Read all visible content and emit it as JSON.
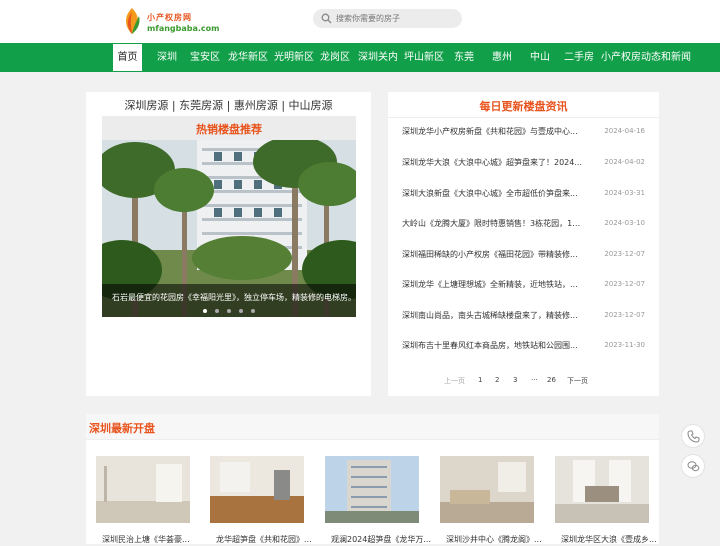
{
  "header": {
    "logo_cn": "小产权房网",
    "logo_en": "mfangbaba.com",
    "search_placeholder": "搜索你需要的房子"
  },
  "nav": [
    "首页",
    "深圳",
    "宝安区",
    "龙华新区",
    "光明新区",
    "龙岗区",
    "深圳关内",
    "坪山新区",
    "东莞",
    "惠州",
    "中山",
    "二手房",
    "小产权房动态和新闻"
  ],
  "left": {
    "cities": "深圳房源 | 东莞房源 | 惠州房源 | 中山房源",
    "hot_title": "热销楼盘推荐",
    "carousel_caption": "石岩最便宜的花园房《幸福阳光里》，独立停车场，精装修的电梯房。",
    "carousel_total": 5,
    "carousel_active": 1
  },
  "news": {
    "title": "每日更新楼盘资讯",
    "items": [
      {
        "t": "深圳龙华小产权房新盘《共和花园》与壹成中心...",
        "d": "2024-04-16"
      },
      {
        "t": "深圳龙华大浪《大浪中心城》超笋盘来了！2024...",
        "d": "2024-04-02"
      },
      {
        "t": "深圳大浪新盘《大浪中心城》全市超低价笋盘来...",
        "d": "2024-03-31"
      },
      {
        "t": "大岭山《龙腾大厦》限时特惠销售！3栋花园，1:...",
        "d": "2024-03-10"
      },
      {
        "t": "深圳福田稀缺的小产权房《福田花园》带精装修...",
        "d": "2023-12-07"
      },
      {
        "t": "深圳龙华《上塘理想城》全新精装，近地铁站，...",
        "d": "2023-12-07"
      },
      {
        "t": "深圳南山尚品，南头古城稀缺楼盘来了，精装修...",
        "d": "2023-12-07"
      },
      {
        "t": "深圳布吉十里春风红本商品房，地铁站和公园围...",
        "d": "2023-11-30"
      }
    ],
    "pager": {
      "prev": "上一页",
      "p1": "1",
      "p2": "2",
      "p3": "3",
      "ellipsis": "···",
      "last": "26",
      "next": "下一页"
    }
  },
  "bottom": {
    "title": "深圳最新开盘",
    "cards": [
      "深圳民治上塘《华荟豪...",
      "龙华超笋盘《共和花园》...",
      "观澜2024超笋盘《龙华万...",
      "深圳沙井中心《腾龙阁》...",
      "深圳龙华区大浪《壹成乡..."
    ]
  },
  "colors": {
    "green": "#11a049",
    "orange": "#e8541e"
  }
}
